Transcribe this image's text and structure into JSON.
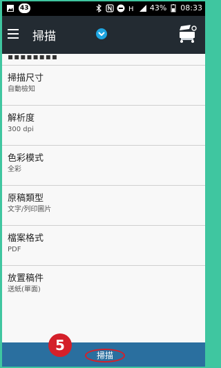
{
  "status_bar": {
    "badge": "43",
    "battery": "43%",
    "time": "08:33"
  },
  "app_bar": {
    "title": "掃描"
  },
  "list": {
    "partial_text": "▪▪▪▪▪▪▪▪",
    "items": [
      {
        "label": "掃描尺寸",
        "value": "自動檢知"
      },
      {
        "label": "解析度",
        "value": "300 dpi"
      },
      {
        "label": "色彩模式",
        "value": "全彩"
      },
      {
        "label": "原稿類型",
        "value": "文字/列印圖片"
      },
      {
        "label": "檔案格式",
        "value": "PDF"
      },
      {
        "label": "放置稿件",
        "value": "送紙(單面)"
      }
    ]
  },
  "bottom_bar": {
    "scan_label": "掃描"
  },
  "annotation": {
    "step": "5"
  },
  "colors": {
    "app_bar": "#232b32",
    "bottom_bar": "#2a6f9f",
    "accent": "#1ea5e0",
    "highlight": "#d4202a",
    "frame": "#3fc6a0"
  }
}
